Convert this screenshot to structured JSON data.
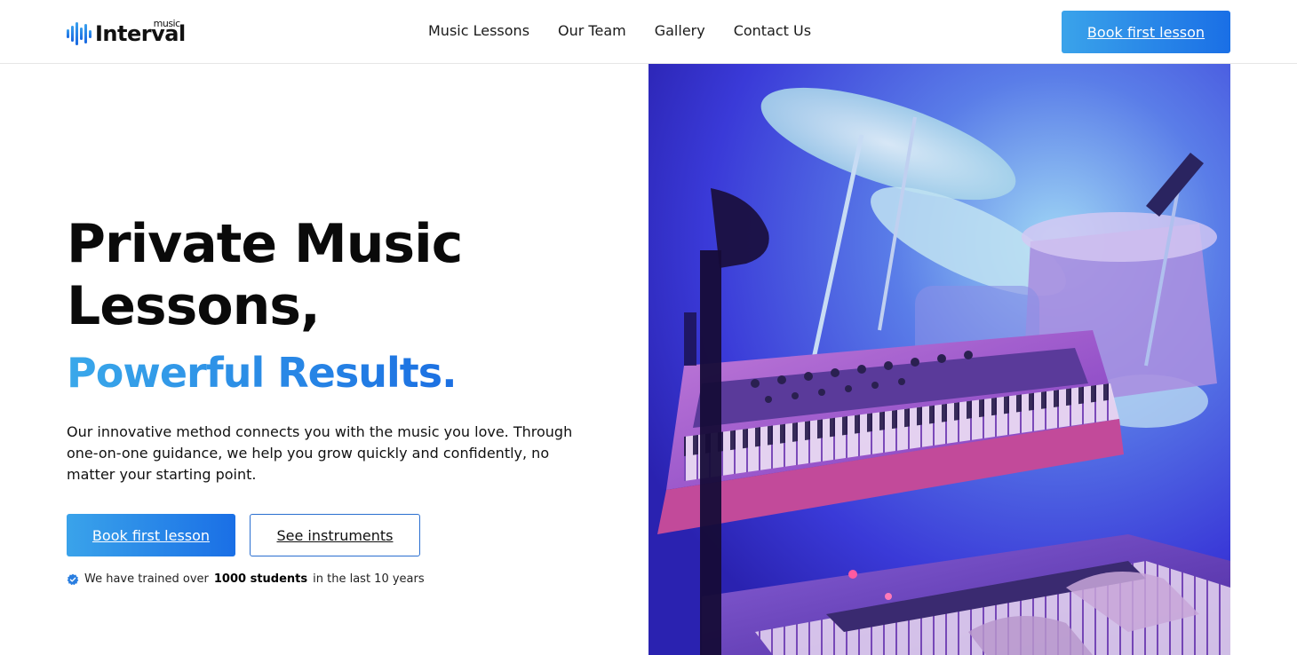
{
  "brand": {
    "name": "Interval",
    "superscript": "music"
  },
  "nav": {
    "items": [
      {
        "label": "Music Lessons"
      },
      {
        "label": "Our Team"
      },
      {
        "label": "Gallery"
      },
      {
        "label": "Contact Us"
      }
    ]
  },
  "header": {
    "cta_label": "Book first lesson"
  },
  "hero": {
    "title": "Private Music Lessons,",
    "accent": "Powerful Results.",
    "description": "Our innovative method connects you with the music you love. Through one-on-one guidance, we help you grow quickly and confidently, no matter your starting point.",
    "primary_cta": "Book first lesson",
    "secondary_cta": "See instruments",
    "trust_prefix": "We have trained over",
    "trust_bold": "1000 students",
    "trust_suffix": "in the last 10 years"
  },
  "colors": {
    "accent_start": "#3aa3ea",
    "accent_end": "#1a6fe6",
    "outline": "#2a6fd0"
  },
  "icons": {
    "logo": "soundwave-icon",
    "trust": "verified-check-icon"
  }
}
